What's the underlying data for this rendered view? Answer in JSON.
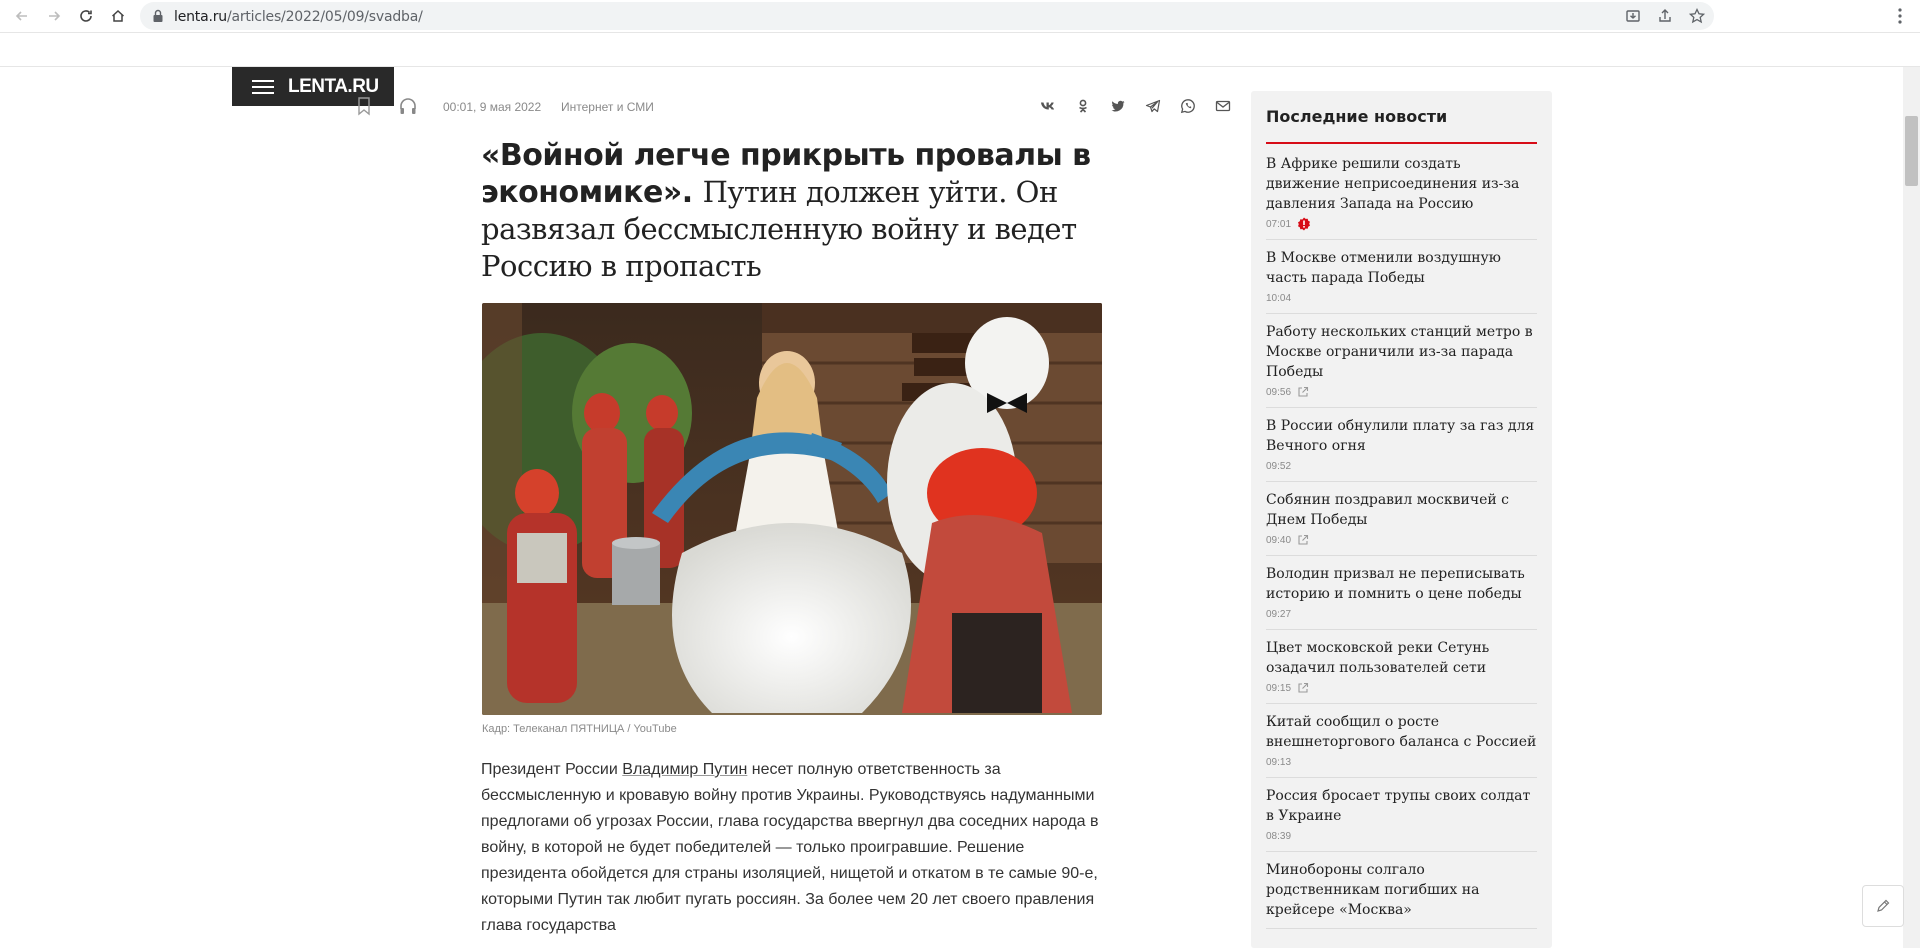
{
  "browser": {
    "url_host": "lenta.ru",
    "url_path": "/articles/2022/05/09/svadba/"
  },
  "site": {
    "logo": "LENTA.RU"
  },
  "article": {
    "date": "00:01, 9 мая 2022",
    "rubric": "Интернет и СМИ",
    "title_bold": "«Войной легче прикрыть провалы в экономике».",
    "title_rest": "Путин должен уйти. Он развязал бессмысленную войну и ведет Россию в пропасть",
    "photo_credit": "Кадр: Телеканал ПЯТНИЦА / YouTube",
    "body_start": "Президент России",
    "body_link": "Владимир Путин",
    "body_rest": "несет полную ответственность за бессмысленную и кровавую войну против Украины. Руководствуясь надуманными предлогами об угрозах России, глава государства ввергнул два соседних народа в войну, в которой не будет победителей — только проигравшие. Решение президента обойдется для страны изоляцией, нищетой и откатом в те самые 90-е, которыми Путин так любит пугать россиян. За более чем 20 лет своего правления глава государства"
  },
  "sidebar": {
    "title": "Последние новости",
    "items": [
      {
        "title": "В Африке решили создать движение неприсоединения из-за давления Запада на Россию",
        "time": "07:01",
        "icon": "alert"
      },
      {
        "title": "В Москве отменили воздушную часть парада Победы",
        "time": "10:04",
        "icon": ""
      },
      {
        "title": "Работу нескольких станций метро в Москве ограничили из-за парада Победы",
        "time": "09:56",
        "icon": "external"
      },
      {
        "title": "В России обнулили плату за газ для Вечного огня",
        "time": "09:52",
        "icon": ""
      },
      {
        "title": "Собянин поздравил москвичей с Днем Победы",
        "time": "09:40",
        "icon": "external"
      },
      {
        "title": "Володин призвал не переписывать историю и помнить о цене победы",
        "time": "09:27",
        "icon": ""
      },
      {
        "title": "Цвет московской реки Сетунь озадачил пользователей сети",
        "time": "09:15",
        "icon": "external"
      },
      {
        "title": "Китай сообщил о росте внешнеторгового баланса с Россией",
        "time": "09:13",
        "icon": ""
      },
      {
        "title": "Россия бросает трупы своих солдат в Украине",
        "time": "08:39",
        "icon": ""
      },
      {
        "title": "Минобороны солгало родственникам погибших на крейсере «Москва»",
        "time": "",
        "icon": ""
      }
    ]
  },
  "colors": {
    "accent": "#d70c17",
    "logo_bg": "#292929",
    "sidebar_bg": "#f2f2f2"
  }
}
